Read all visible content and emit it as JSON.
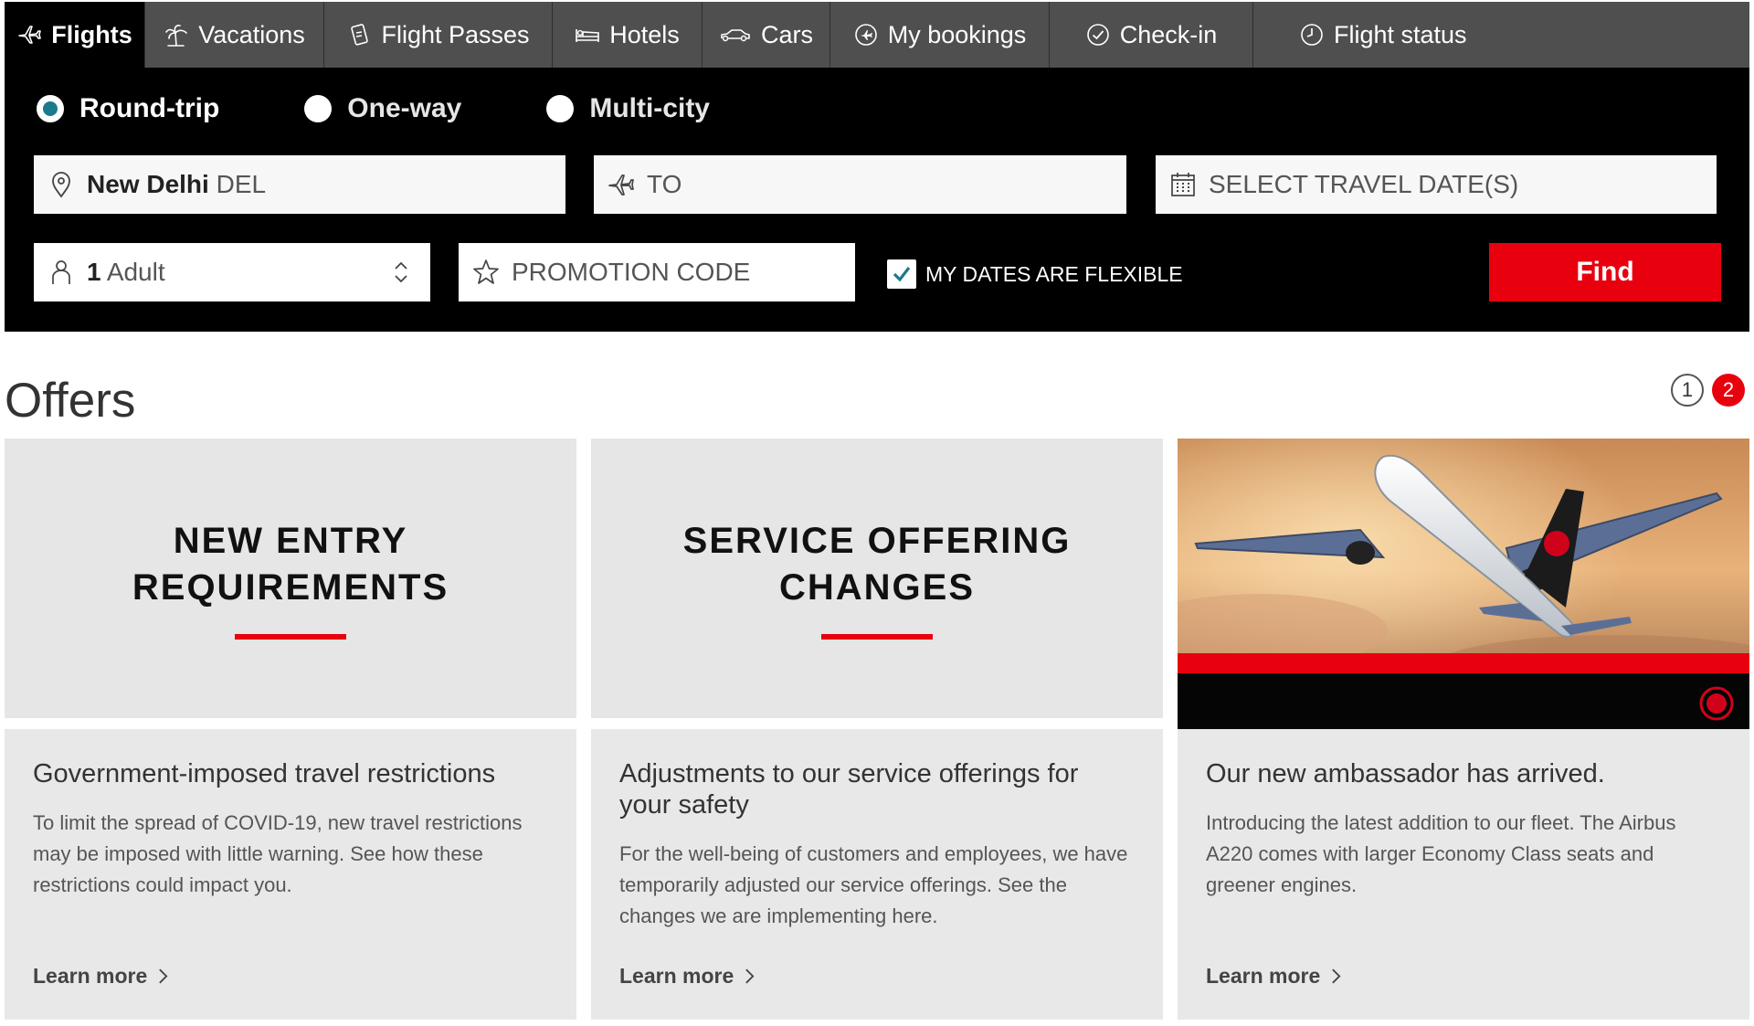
{
  "tabs": [
    {
      "label": "Flights",
      "icon": "plane-icon",
      "active": true
    },
    {
      "label": "Vacations",
      "icon": "palm-tree-icon"
    },
    {
      "label": "Flight Passes",
      "icon": "flight-pass-icon"
    },
    {
      "label": "Hotels",
      "icon": "bed-icon"
    },
    {
      "label": "Cars",
      "icon": "car-icon"
    },
    {
      "label": "My bookings",
      "icon": "bookings-icon"
    },
    {
      "label": "Check-in",
      "icon": "check-circle-icon"
    },
    {
      "label": "Flight status",
      "icon": "clock-icon"
    }
  ],
  "trip_types": [
    {
      "label": "Round-trip",
      "selected": true
    },
    {
      "label": "One-way",
      "selected": false
    },
    {
      "label": "Multi-city",
      "selected": false
    }
  ],
  "search": {
    "from_city": "New Delhi",
    "from_code": "DEL",
    "to_placeholder": "TO",
    "date_placeholder": "SELECT TRAVEL DATE(S)",
    "passengers_count": "1",
    "passengers_type": "Adult",
    "promo_placeholder": "PROMOTION CODE",
    "flexible_label": "MY DATES ARE FLEXIBLE",
    "flexible_checked": true,
    "find_label": "Find"
  },
  "offers": {
    "title": "Offers",
    "pages": [
      "1",
      "2"
    ],
    "current_page": "2",
    "cards": [
      {
        "banner_line1": "NEW ENTRY",
        "banner_line2": "REQUIREMENTS",
        "heading": "Government-imposed travel restrictions",
        "text": "To limit the spread of COVID-19, new travel restrictions may be imposed with little warning. See how these restrictions could impact you.",
        "link": "Learn more"
      },
      {
        "banner_line1": "SERVICE OFFERING",
        "banner_line2": "CHANGES",
        "heading": "Adjustments to our service offerings for your safety",
        "text": "For the well-being of customers and employees, we have temporarily adjusted our service offerings. See the changes we are implementing here.",
        "link": "Learn more"
      },
      {
        "image": "airbus-a220-in-clouds",
        "heading": "Our new ambassador has arrived.",
        "text": "Introducing the latest addition to our fleet. The Airbus A220 comes with larger Economy Class seats and greener engines.",
        "link": "Learn more"
      }
    ]
  },
  "colors": {
    "brand_red": "#e8000e",
    "tab_bar": "#4f4f4f",
    "panel": "#000000",
    "card_bg": "#e6e6e6",
    "radio_accent": "#1b7a8c"
  }
}
